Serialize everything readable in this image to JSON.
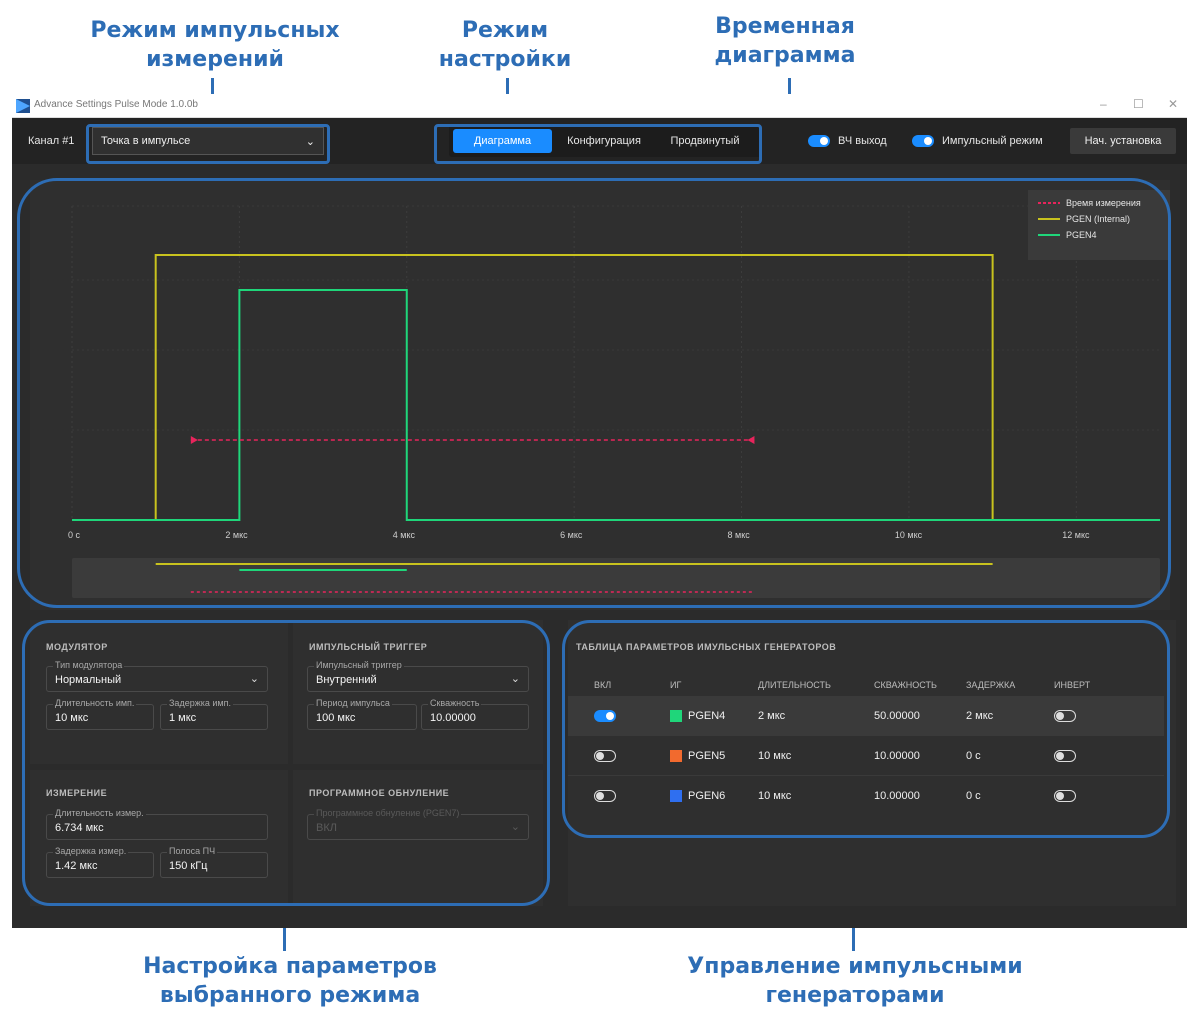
{
  "annotations": {
    "pulse_mode": "Режим импульсных измерений",
    "setup_mode": "Режим настройки",
    "timing": "Временная диаграмма",
    "params": "Настройка параметров выбранного режима",
    "generators": "Управление импульсными генераторами"
  },
  "window": {
    "title": "Advance Settings Pulse Mode 1.0.0b",
    "minimize": "–",
    "maximize": "☐",
    "close": "✕"
  },
  "toolbar": {
    "channel_label": "Канал #1",
    "mode_value": "Точка в импульсе",
    "tabs": [
      "Диаграмма",
      "Конфигурация",
      "Продвинутый"
    ],
    "rf_out_label": "ВЧ выход",
    "pulse_mode_label": "Импульсный режим",
    "preset_label": "Нач. установка"
  },
  "chart_data": {
    "type": "line",
    "xlim": [
      0,
      13
    ],
    "x_unit": "мкс",
    "ticks": [
      "0 с",
      "2 мкс",
      "4 мкс",
      "6 мкс",
      "8 мкс",
      "10 мкс",
      "12 мкс"
    ],
    "tick_values": [
      0,
      2,
      4,
      6,
      8,
      10,
      12
    ],
    "grid": true,
    "legend_position": "top-right",
    "series": [
      {
        "name": "Время измерения",
        "color": "#e8245c",
        "style": "dashed-arrow",
        "start": 1.42,
        "end": 8.154
      },
      {
        "name": "PGEN (Internal)",
        "color": "#c8c21e",
        "style": "pulse",
        "start": 1.0,
        "end": 11.0
      },
      {
        "name": "PGEN4",
        "color": "#1fd67a",
        "style": "pulse",
        "start": 2.0,
        "end": 4.0
      }
    ]
  },
  "modulator": {
    "title": "МОДУЛЯТОР",
    "type_caption": "Тип модулятора",
    "type_value": "Нормальный",
    "width_caption": "Длительность имп.",
    "width_value": "10 мкс",
    "delay_caption": "Задержка имп.",
    "delay_value": "1 мкс"
  },
  "trigger": {
    "title": "ИМПУЛЬСНЫЙ ТРИГГЕР",
    "trigger_caption": "Импульсный триггер",
    "trigger_value": "Внутренний",
    "period_caption": "Период импульса",
    "period_value": "100 мкс",
    "duty_caption": "Скважность",
    "duty_value": "10.00000"
  },
  "measurement": {
    "title": "ИЗМЕРЕНИЕ",
    "dur_caption": "Длительность измер.",
    "dur_value": "6.734 мкс",
    "delay_caption": "Задержка измер.",
    "delay_value": "1.42 мкс",
    "bw_caption": "Полоса ПЧ",
    "bw_value": "150 кГц"
  },
  "soft_reset": {
    "title": "ПРОГРАММНОЕ ОБНУЛЕНИЕ",
    "caption": "Программное обнуление (PGEN7)",
    "value": "ВКЛ"
  },
  "gen_table": {
    "title": "ТАБЛИЦА ПАРАМЕТРОВ ИМУЛЬСНЫХ ГЕНЕРАТОРОВ",
    "headers": [
      "ВКЛ",
      "ИГ",
      "ДЛИТЕЛЬНОСТЬ",
      "СКВАЖНОСТЬ",
      "ЗАДЕРЖКА",
      "ИНВЕРТ"
    ],
    "rows": [
      {
        "name": "PGEN4",
        "color": "#1fd67a",
        "on": true,
        "width": "2 мкс",
        "duty": "50.00000",
        "delay": "2 мкс",
        "invert": false
      },
      {
        "name": "PGEN5",
        "color": "#f26a2e",
        "on": false,
        "width": "10 мкс",
        "duty": "10.00000",
        "delay": "0 с",
        "invert": false
      },
      {
        "name": "PGEN6",
        "color": "#2f6ff0",
        "on": false,
        "width": "10 мкс",
        "duty": "10.00000",
        "delay": "0 с",
        "invert": false
      }
    ]
  }
}
